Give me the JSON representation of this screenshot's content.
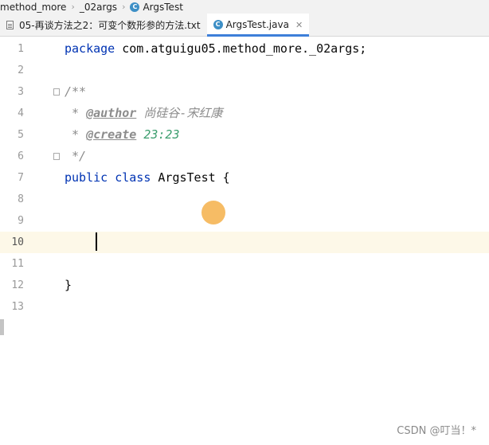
{
  "breadcrumb": {
    "items": [
      "method_more",
      "_02args",
      "ArgsTest"
    ]
  },
  "tabs": [
    {
      "label": "05-再谈方法之2：可变个数形参的方法.txt",
      "icon": "text-file-icon",
      "active": false
    },
    {
      "label": "ArgsTest.java",
      "icon": "java-class-icon",
      "active": true
    }
  ],
  "editor": {
    "line_numbers": [
      "1",
      "2",
      "3",
      "4",
      "5",
      "6",
      "7",
      "8",
      "9",
      "10",
      "11",
      "12",
      "13"
    ],
    "current_line": "10",
    "lines": {
      "l1_kw": "package",
      "l1_rest": " com.atguigu05.method_more._02args;",
      "l3": "/**",
      "l4_star": " * ",
      "l4_tag": "@author",
      "l4_val": " 尚硅谷-宋红康",
      "l5_star": " * ",
      "l5_tag": "@create",
      "l5_val": " 23:23",
      "l6": " */",
      "l7_kw": "public class",
      "l7_rest": " ArgsTest {",
      "l12": "}"
    }
  },
  "watermark": "CSDN @叮当！*"
}
